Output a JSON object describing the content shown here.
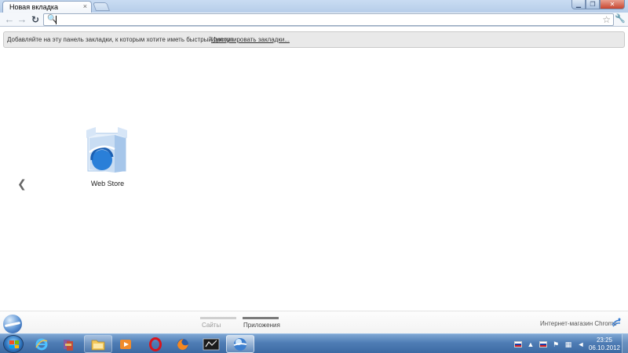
{
  "browser": {
    "tab_title": "Новая вкладка",
    "tab_close_glyph": "×",
    "bookmark_bar_text": "Добавляйте на эту панель закладки, к которым хотите иметь быстрый доступ.",
    "bookmark_bar_link": "Импортировать закладки...",
    "omnibox_value": ""
  },
  "ntp": {
    "apps": [
      {
        "label": "Web Store",
        "icon": "web-store-icon"
      }
    ],
    "page_switcher": [
      {
        "label": "Сайты",
        "active": false
      },
      {
        "label": "Приложения",
        "active": true
      }
    ],
    "store_link": "Интернет-магазин Chrome"
  },
  "taskbar": {
    "pinned": [
      "internet-explorer-icon",
      "winrar-icon",
      "explorer-folder-icon",
      "media-player-icon",
      "opera-icon",
      "firefox-icon",
      "app-icon",
      "browser-icon"
    ],
    "tray_flags": [
      "ru-flag-icon",
      "ru-flag-icon"
    ],
    "clock_time": "23:25",
    "clock_date": "06.10.2012"
  },
  "colors": {
    "accent": "#3c6aa3",
    "store_blue": "#2a7fd8"
  }
}
